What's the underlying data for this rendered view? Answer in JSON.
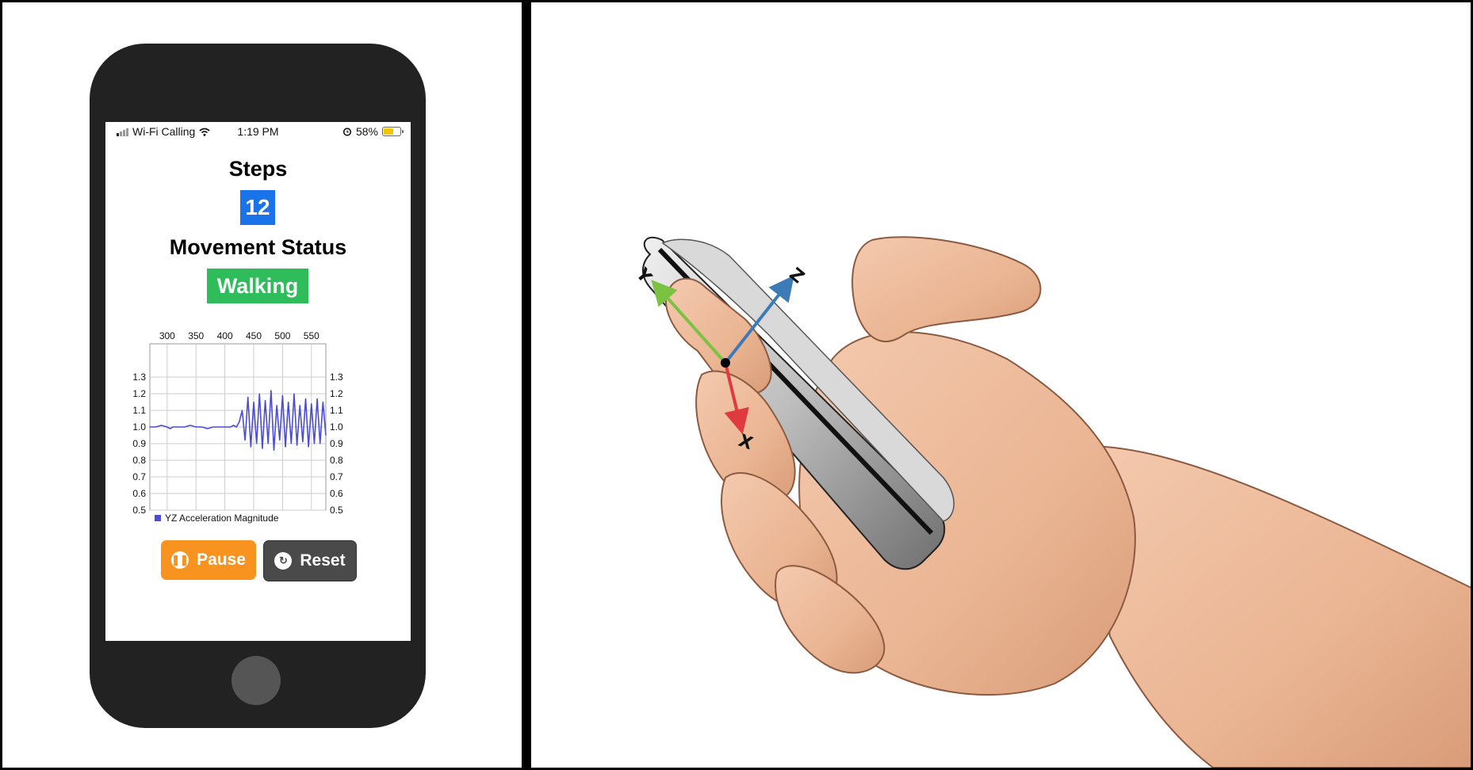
{
  "status_bar": {
    "carrier": "Wi-Fi Calling",
    "time": "1:19 PM",
    "battery": "58%",
    "battery_level": 0.58
  },
  "app": {
    "steps_title": "Steps",
    "steps_count": "12",
    "movement_title": "Movement Status",
    "movement_value": "Walking",
    "pause_label": "Pause",
    "reset_label": "Reset"
  },
  "colors": {
    "steps_badge": "#1a73e8",
    "walking_badge": "#2ebd5a",
    "pause": "#f7931e",
    "reset": "#4a4a4a",
    "series": "#4b4bd6"
  },
  "icons": {
    "pause": "pause-circle-icon",
    "reset": "refresh-icon",
    "signal": "signal-bars-icon",
    "wifi": "wifi-icon",
    "alarm": "alarm-icon",
    "battery": "battery-icon"
  },
  "chart_data": {
    "type": "line",
    "title": "",
    "xlabel": "",
    "ylabel": "",
    "xlim": [
      270,
      575
    ],
    "ylim": [
      0.5,
      1.5
    ],
    "x_ticks": [
      "300",
      "350",
      "400",
      "450",
      "500",
      "550"
    ],
    "y_ticks": [
      "0.5",
      "0.6",
      "0.7",
      "0.8",
      "0.9",
      "1.0",
      "1.1",
      "1.2",
      "1.3"
    ],
    "grid": true,
    "legend_position": "bottom-left",
    "series": [
      {
        "name": "YZ Acceleration Magnitude",
        "x": [
          270,
          280,
          290,
          300,
          305,
          310,
          320,
          330,
          340,
          350,
          360,
          370,
          380,
          390,
          400,
          410,
          415,
          420,
          425,
          430,
          435,
          440,
          445,
          450,
          455,
          460,
          465,
          470,
          475,
          480,
          485,
          490,
          495,
          500,
          505,
          510,
          515,
          520,
          525,
          530,
          535,
          540,
          545,
          550,
          555,
          560,
          565,
          570,
          575
        ],
        "y": [
          1.0,
          1.0,
          1.01,
          1.0,
          0.99,
          1.0,
          1.0,
          1.0,
          1.01,
          1.0,
          1.0,
          0.99,
          1.0,
          1.0,
          1.0,
          1.0,
          1.01,
          1.0,
          1.03,
          1.1,
          0.92,
          1.18,
          0.88,
          1.15,
          0.9,
          1.2,
          0.87,
          1.16,
          0.9,
          1.22,
          0.86,
          1.13,
          0.92,
          1.19,
          0.88,
          1.15,
          0.9,
          1.2,
          0.89,
          1.13,
          0.91,
          1.17,
          0.88,
          1.14,
          0.9,
          1.17,
          0.9,
          1.15,
          0.95
        ]
      }
    ]
  },
  "diagram": {
    "axis_x": "X",
    "axis_y": "Y",
    "axis_z": "Z"
  }
}
